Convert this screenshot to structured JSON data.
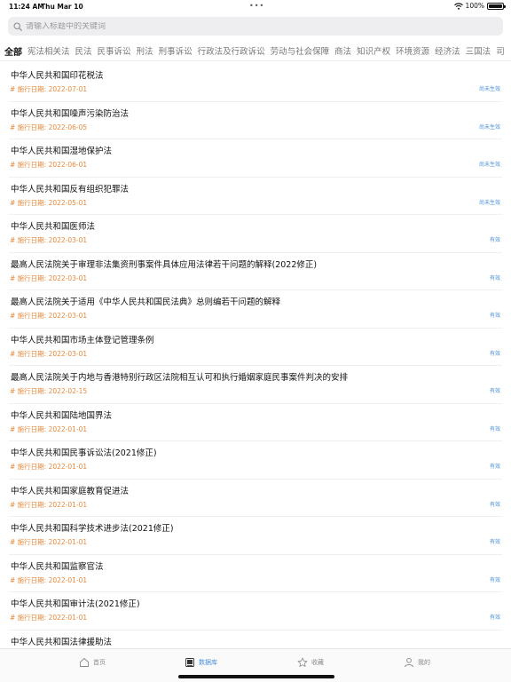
{
  "status_bar": {
    "time": "11:24 AM",
    "date": "Thu Mar 10",
    "dots": "•••",
    "battery": "100%"
  },
  "search": {
    "placeholder": "请输入标题中的关键词"
  },
  "tabs": [
    {
      "label": "全部",
      "active": true
    },
    {
      "label": "宪法相关法"
    },
    {
      "label": "民法"
    },
    {
      "label": "民事诉讼"
    },
    {
      "label": "刑法"
    },
    {
      "label": "刑事诉讼"
    },
    {
      "label": "行政法及行政诉讼"
    },
    {
      "label": "劳动与社会保障"
    },
    {
      "label": "商法"
    },
    {
      "label": "知识产权"
    },
    {
      "label": "环境资源"
    },
    {
      "label": "经济法"
    },
    {
      "label": "三国法"
    },
    {
      "label": "司"
    }
  ],
  "laws": [
    {
      "title": "中华人民共和国印花税法",
      "date": "# 施行日期: 2022-07-01",
      "status": "尚未生效"
    },
    {
      "title": "中华人民共和国噪声污染防治法",
      "date": "# 施行日期: 2022-06-05",
      "status": "尚未生效"
    },
    {
      "title": "中华人民共和国湿地保护法",
      "date": "# 施行日期: 2022-06-01",
      "status": "尚未生效"
    },
    {
      "title": "中华人民共和国反有组织犯罪法",
      "date": "# 施行日期: 2022-05-01",
      "status": "尚未生效"
    },
    {
      "title": "中华人民共和国医师法",
      "date": "# 施行日期: 2022-03-01",
      "status": "有效"
    },
    {
      "title": "最高人民法院关于审理非法集资刑事案件具体应用法律若干问题的解释(2022修正)",
      "date": "# 施行日期: 2022-03-01",
      "status": "有效"
    },
    {
      "title": "最高人民法院关于适用《中华人民共和国民法典》总则编若干问题的解释",
      "date": "# 施行日期: 2022-03-01",
      "status": "有效"
    },
    {
      "title": "中华人民共和国市场主体登记管理条例",
      "date": "# 施行日期: 2022-03-01",
      "status": "有效"
    },
    {
      "title": "最高人民法院关于内地与香港特别行政区法院相互认可和执行婚姻家庭民事案件判决的安排",
      "date": "# 施行日期: 2022-02-15",
      "status": "有效"
    },
    {
      "title": "中华人民共和国陆地国界法",
      "date": "# 施行日期: 2022-01-01",
      "status": "有效"
    },
    {
      "title": "中华人民共和国民事诉讼法(2021修正)",
      "date": "# 施行日期: 2022-01-01",
      "status": "有效"
    },
    {
      "title": "中华人民共和国家庭教育促进法",
      "date": "# 施行日期: 2022-01-01",
      "status": "有效"
    },
    {
      "title": "中华人民共和国科学技术进步法(2021修正)",
      "date": "# 施行日期: 2022-01-01",
      "status": "有效"
    },
    {
      "title": "中华人民共和国监察官法",
      "date": "# 施行日期: 2022-01-01",
      "status": "有效"
    },
    {
      "title": "中华人民共和国审计法(2021修正)",
      "date": "# 施行日期: 2022-01-01",
      "status": "有效"
    },
    {
      "title": "中华人民共和国法律援助法",
      "date": "",
      "status": ""
    }
  ],
  "tabbar": [
    {
      "label": "首页",
      "icon": "home-icon"
    },
    {
      "label": "数据库",
      "icon": "book-icon",
      "active": true
    },
    {
      "label": "收藏",
      "icon": "star-icon"
    },
    {
      "label": "我的",
      "icon": "person-icon"
    }
  ],
  "colors": {
    "accent": "#4a90d9",
    "date": "#e8893a"
  }
}
